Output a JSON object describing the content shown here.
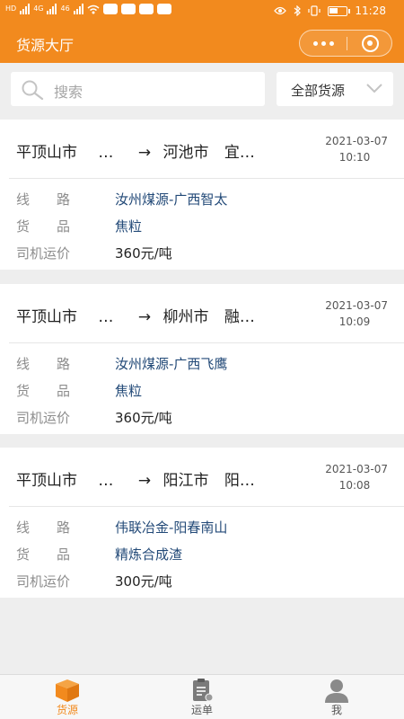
{
  "status_bar": {
    "time": "11:28",
    "signal_labels": [
      "HD",
      "4G",
      "46"
    ],
    "battery_level": 0.55
  },
  "header": {
    "title": "货源大厅",
    "colors": {
      "brand": "#f28a1e"
    }
  },
  "filter": {
    "search_placeholder": "搜索",
    "dropdown_label": "全部货源"
  },
  "cards": [
    {
      "origin": "平顶山市",
      "origin_more": "…",
      "arrow": "→",
      "dest": "河池市",
      "dest_more": "宜…",
      "date": "2021-03-07",
      "time": "10:10",
      "route_label": "线　　路",
      "route_value": "汝州煤源-广西智太",
      "goods_label": "货　　品",
      "goods_value": "焦粒",
      "price_label": "司机运价",
      "price_value": "360元/吨"
    },
    {
      "origin": "平顶山市",
      "origin_more": "…",
      "arrow": "→",
      "dest": "柳州市",
      "dest_more": "融…",
      "date": "2021-03-07",
      "time": "10:09",
      "route_label": "线　　路",
      "route_value": "汝州煤源-广西飞鹰",
      "goods_label": "货　　品",
      "goods_value": "焦粒",
      "price_label": "司机运价",
      "price_value": "360元/吨"
    },
    {
      "origin": "平顶山市",
      "origin_more": "…",
      "arrow": "→",
      "dest": "阳江市",
      "dest_more": "阳…",
      "date": "2021-03-07",
      "time": "10:08",
      "route_label": "线　　路",
      "route_value": "伟联冶金-阳春南山",
      "goods_label": "货　　品",
      "goods_value": "精炼合成渣",
      "price_label": "司机运价",
      "price_value": "300元/吨"
    }
  ],
  "tabbar": {
    "tabs": [
      {
        "label": "货源",
        "icon": "cargo-box-icon",
        "active": true
      },
      {
        "label": "运单",
        "icon": "waybill-icon",
        "active": false
      },
      {
        "label": "我",
        "icon": "user-icon",
        "active": false
      }
    ]
  }
}
